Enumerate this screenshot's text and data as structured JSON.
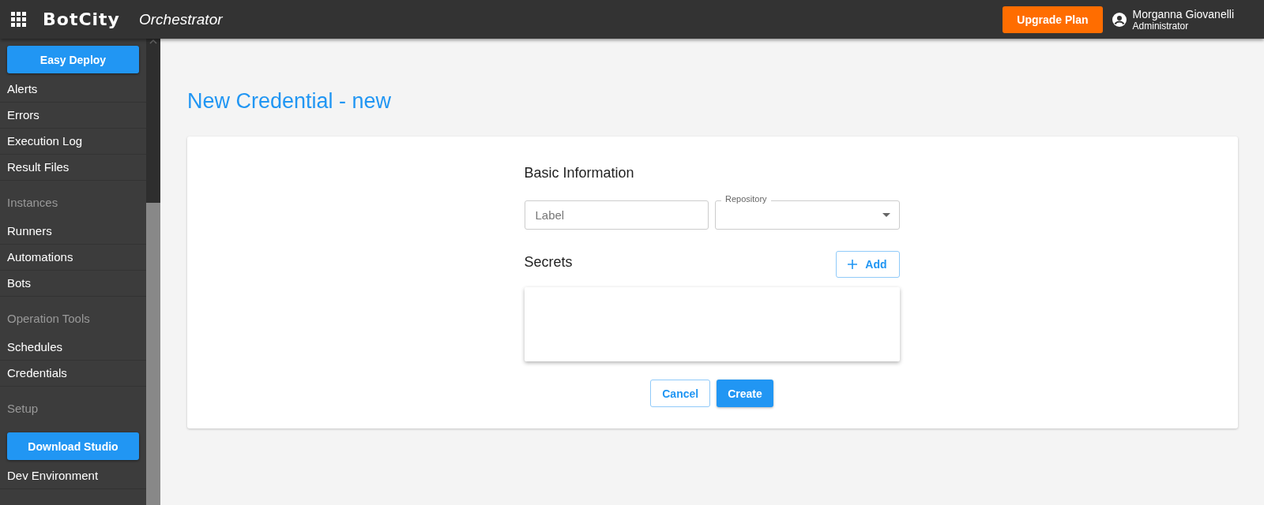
{
  "topbar": {
    "logo": "BotCity",
    "product": "Orchestrator",
    "upgrade_button": "Upgrade Plan",
    "user": {
      "name": "Morganna Giovanelli",
      "role": "Administrator"
    }
  },
  "sidebar": {
    "items": [
      {
        "kind": "button",
        "label": "Easy Deploy"
      },
      {
        "kind": "link",
        "label": "Alerts"
      },
      {
        "kind": "link",
        "label": "Errors"
      },
      {
        "kind": "link",
        "label": "Execution Log"
      },
      {
        "kind": "link",
        "label": "Result Files"
      },
      {
        "kind": "header",
        "label": "Instances"
      },
      {
        "kind": "link",
        "label": "Runners"
      },
      {
        "kind": "link",
        "label": "Automations"
      },
      {
        "kind": "link",
        "label": "Bots"
      },
      {
        "kind": "header",
        "label": "Operation Tools"
      },
      {
        "kind": "link",
        "label": "Schedules"
      },
      {
        "kind": "link",
        "label": "Credentials"
      },
      {
        "kind": "header",
        "label": "Setup"
      },
      {
        "kind": "button",
        "label": "Download Studio"
      },
      {
        "kind": "link",
        "label": "Dev Environment"
      }
    ]
  },
  "page_title": "New Credential - new",
  "form": {
    "basic_heading": "Basic Information",
    "label_field": {
      "placeholder": "Label"
    },
    "repository_field": {
      "label": "Repository"
    },
    "secrets_heading": "Secrets",
    "add_button": "Add",
    "cancel_button": "Cancel",
    "create_button": "Create"
  }
}
